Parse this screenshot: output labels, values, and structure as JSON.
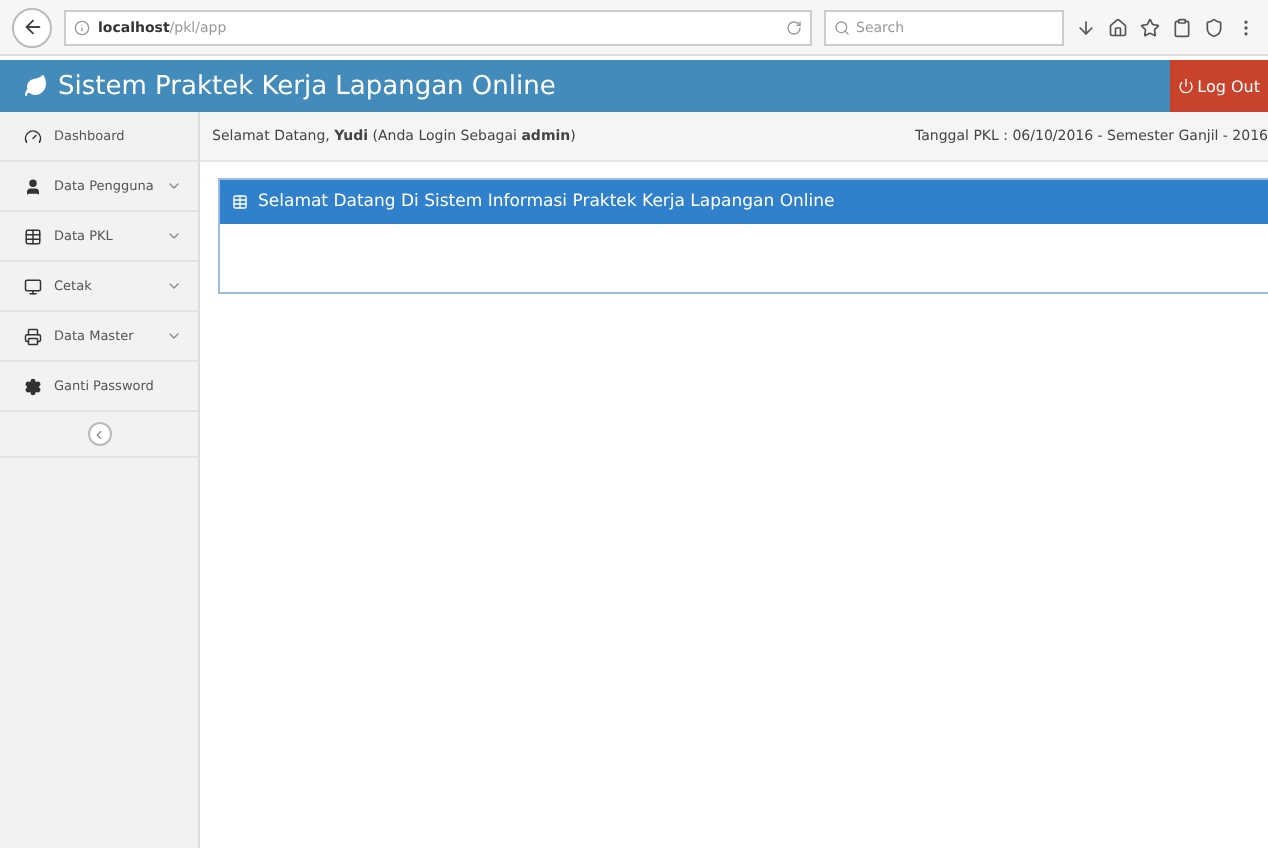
{
  "browser": {
    "address_host": "localhost",
    "address_path": "/pkl/app",
    "search_placeholder": "Search"
  },
  "header": {
    "title": "Sistem Praktek Kerja Lapangan Online",
    "logout": "Log Out"
  },
  "sidebar": {
    "items": [
      {
        "label": "Dashboard",
        "expandable": false
      },
      {
        "label": "Data Pengguna",
        "expandable": true
      },
      {
        "label": "Data PKL",
        "expandable": true
      },
      {
        "label": "Cetak",
        "expandable": true
      },
      {
        "label": "Data Master",
        "expandable": true
      },
      {
        "label": "Ganti Password",
        "expandable": false
      }
    ]
  },
  "infobar": {
    "greeting": "Selamat Datang, **Yudi** (Anda Login Sebagai **admin**)",
    "date": "Tanggal PKL : 06/10/2016 - Semester Ganjil - 2016"
  },
  "panel": {
    "title": "Selamat Datang Di Sistem Informasi Praktek Kerja Lapangan Online"
  }
}
